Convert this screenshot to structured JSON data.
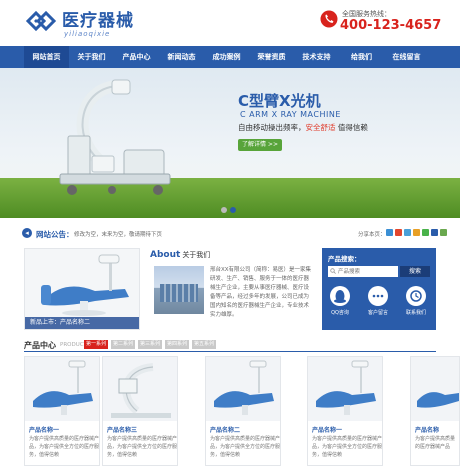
{
  "header": {
    "logo_title": "医疗器械",
    "logo_sub": "yiliaoqixie",
    "hotline_label": "全国服务热线：",
    "hotline_number": "400-123-4657"
  },
  "nav": {
    "items": [
      "网站首页",
      "关于我们",
      "产品中心",
      "新闻动态",
      "成功案例",
      "荣誉资质",
      "技术支持",
      "给我们",
      "在线留言"
    ]
  },
  "banner": {
    "title": "C型臂X光机",
    "en": "C ARM X RAY MACHINE",
    "slogan_a": "自由移动操出频率，",
    "slogan_b": "安全舒适",
    "slogan_c": "值得信赖",
    "button": "了解详情 >>"
  },
  "notice": {
    "label": "网站公告：",
    "text": "修改为空，末来为空，敬请期待下页",
    "share_label": "分享本页："
  },
  "featured": {
    "caption": "新品上市：产品名称二"
  },
  "about": {
    "title_en": "About",
    "title_cn": "关于我们",
    "text": "邢台XX有限公司（简称：易医）是一家集研发、生产、销售、服务于一体的医疗器械生产企业，主要从事医疗器械、医疗设备等产品，经过多年的发展，公司已成为国内知名的医疗器械生产企业，专业技术实力雄厚。"
  },
  "search": {
    "title": "产品搜索：",
    "placeholder": "产品搜索",
    "button": "搜索",
    "services": [
      "QQ咨询",
      "客户留言",
      "联系我们"
    ]
  },
  "products": {
    "title": "产品中心",
    "title_en": "PRODUCTS",
    "tabs": [
      "第一系列",
      "第二系列",
      "第三系列",
      "第四系列",
      "第五系列"
    ],
    "items": [
      {
        "name": "产品名称一",
        "desc": "为客户提供高质量的医疗器械产品，为客户提供全方位的医疗服务，值得信赖"
      },
      {
        "name": "产品名称三",
        "desc": "为客户提供高质量的医疗器械产品，为客户提供全方位的医疗服务，值得信赖"
      },
      {
        "name": "产品名称二",
        "desc": "为客户提供高质量的医疗器械产品，为客户提供全方位的医疗服务，值得信赖"
      },
      {
        "name": "产品名称一",
        "desc": "为客户提供高质量的医疗器械产品，为客户提供全方位的医疗服务，值得信赖"
      },
      {
        "name": "产品名称",
        "desc": "为客户提供高质量的医疗器械产品"
      }
    ]
  },
  "colors": {
    "brand": "#2a5caa",
    "accent_red": "#d8231d",
    "green": "#58a43a"
  }
}
